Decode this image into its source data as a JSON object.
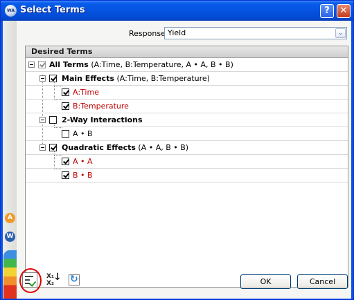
{
  "window": {
    "icon_text": "WA",
    "title": "Select Terms",
    "help_glyph": "?",
    "close_glyph": "✕"
  },
  "sidebar": {
    "badge_a": "A",
    "badge_w": "W"
  },
  "response": {
    "label": "Response",
    "value": "Yield",
    "arrow": "⌄"
  },
  "panel": {
    "title": "Desired Terms"
  },
  "tree": {
    "all_terms": {
      "label": "All Terms",
      "detail": " (A:Time, B:Temperature, A • A, B • B)",
      "checked": true
    },
    "main_effects": {
      "label": "Main Effects",
      "detail": " (A:Time, B:Temperature)",
      "checked": true
    },
    "a_time": {
      "label": "A:Time",
      "checked": true
    },
    "b_temperature": {
      "label": "B:Temperature",
      "checked": true
    },
    "two_way": {
      "label": "2-Way Interactions",
      "detail": "",
      "checked": false
    },
    "a_b": {
      "label": "A • B",
      "checked": false
    },
    "quadratic": {
      "label": "Quadratic Effects",
      "detail": " (A • A, B • B)",
      "checked": true
    },
    "a_a": {
      "label": "A • A",
      "checked": true
    },
    "b_b": {
      "label": "B • B",
      "checked": true
    }
  },
  "toolbar": {
    "sort_icon_text_top": "X₁",
    "sort_icon_text_bottom": "X₂",
    "sort_arrow": "↓"
  },
  "buttons": {
    "ok": "OK",
    "cancel": "Cancel"
  },
  "colors": {
    "selected_term": "#c00000",
    "title_bar": "#0553e0",
    "highlight_circle": "#e00000"
  }
}
